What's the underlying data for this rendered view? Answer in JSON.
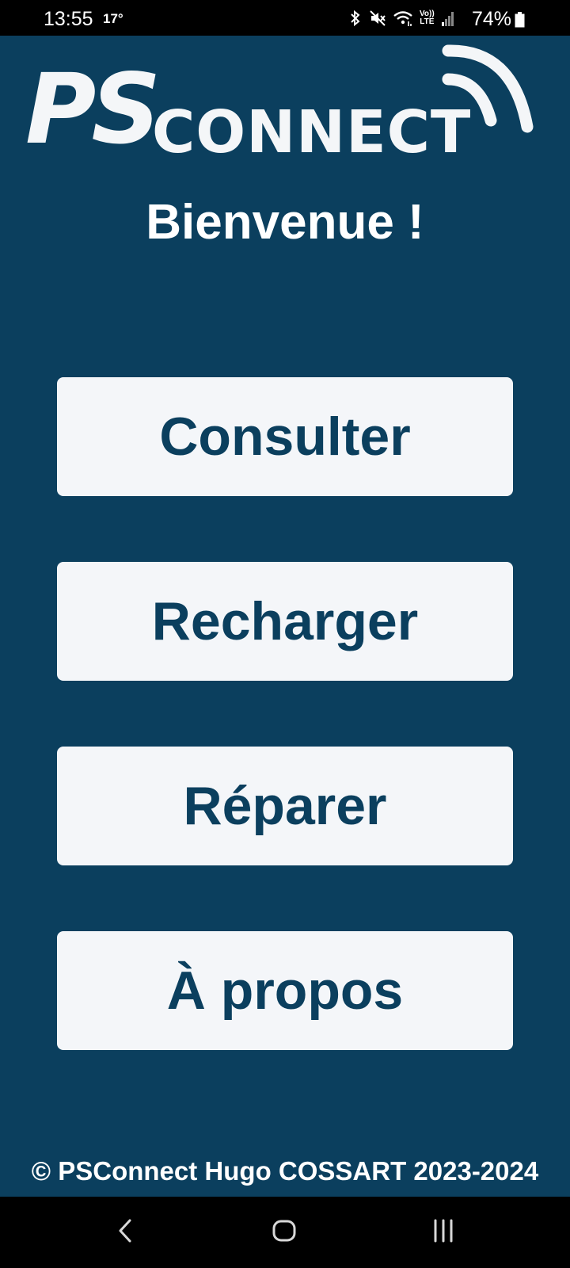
{
  "status_bar": {
    "time": "13:55",
    "temperature": "17°",
    "battery_percent": "74%",
    "icons": [
      "bluetooth-icon",
      "mute-icon",
      "wifi-icon",
      "volte-icon",
      "signal-icon",
      "battery-icon"
    ],
    "volte_label_top": "Vo))",
    "volte_label_bottom": "LTE"
  },
  "logo": {
    "ps": "PS",
    "connect": "CONNECT"
  },
  "title": "Bienvenue !",
  "menu": {
    "consult_label": "Consulter",
    "reload_label": "Recharger",
    "repair_label": "Réparer",
    "about_label": "À propos"
  },
  "footer": "© PSConnect Hugo COSSART 2023-2024",
  "colors": {
    "background": "#0b3f5e",
    "button_bg": "#f4f6f9",
    "button_text": "#0b3f5e",
    "text": "#ffffff"
  },
  "nav_bar": {
    "icons": [
      "back-icon",
      "home-icon",
      "recents-icon"
    ]
  }
}
